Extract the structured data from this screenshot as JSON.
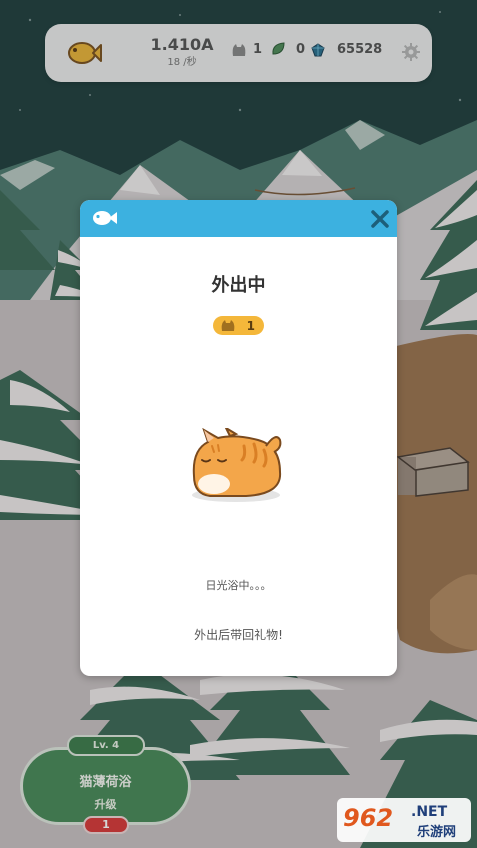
{
  "topbar": {
    "currency_amount": "1.410A",
    "currency_rate": "18 /秒",
    "cats_count": "1",
    "leaves_count": "0",
    "gems_count": "65528",
    "icons": [
      "fish-coin-icon",
      "cat-icon",
      "leaf-icon",
      "gem-icon",
      "gear-icon"
    ]
  },
  "modal": {
    "header_icon": "fish-icon",
    "close_icon": "close-icon",
    "title": "外出中",
    "badge_count": "1",
    "status_text": "日光浴中。。。",
    "hint_text": "外出后带回礼物!"
  },
  "upgrade": {
    "level": "Lv. 4",
    "name": "猫薄荷浴",
    "action": "升级",
    "cost": "1"
  },
  "watermark": {
    "brand": "962",
    "suffix": ".NET",
    "site": "乐游网"
  },
  "colors": {
    "header_blue": "#3cb1e0",
    "badge_orange": "#f4b73a",
    "upgrade_green": "#4a8a5a",
    "cost_red": "#d83a3a",
    "sky": "#1f3f3e"
  }
}
